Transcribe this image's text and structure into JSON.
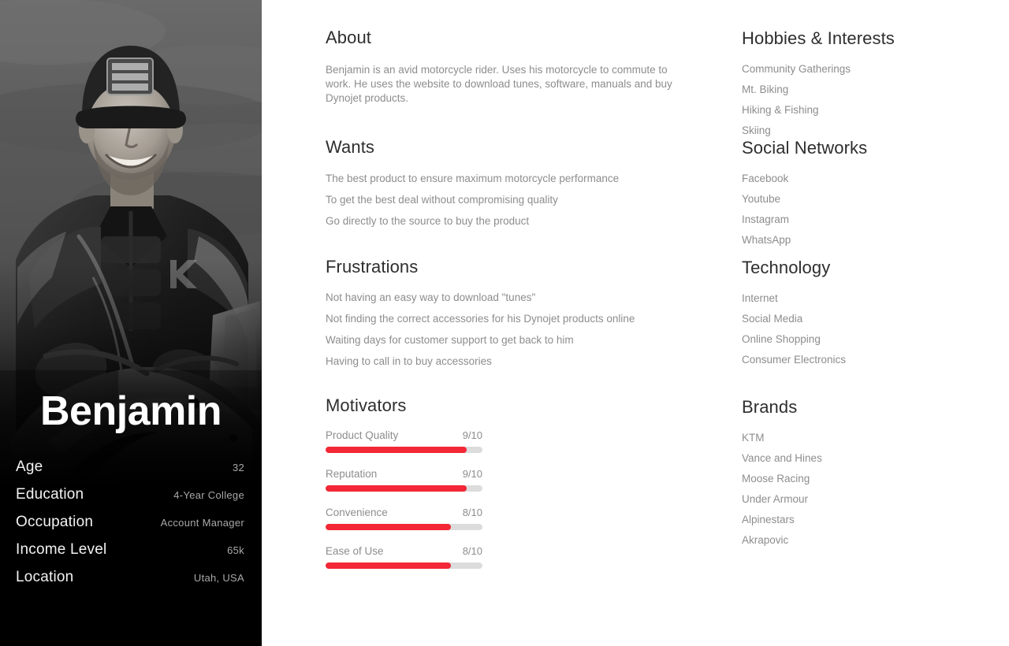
{
  "profile": {
    "name": "Benjamin",
    "photo_alt": "motorcycle-rider-portrait",
    "stats": [
      {
        "label": "Age",
        "value": "32"
      },
      {
        "label": "Education",
        "value": "4-Year College"
      },
      {
        "label": "Occupation",
        "value": "Account Manager"
      },
      {
        "label": "Income Level",
        "value": "65k"
      },
      {
        "label": "Location",
        "value": "Utah, USA"
      }
    ]
  },
  "about": {
    "title": "About",
    "text": "Benjamin is an avid motorcycle rider. Uses his motorcycle to commute to work.  He uses the website to download tunes, software, manuals and buy Dynojet products."
  },
  "wants": {
    "title": "Wants",
    "items": [
      "The best product to ensure maximum motorcycle performance",
      "To get the best deal without compromising quality",
      "Go directly to the source to buy the product"
    ]
  },
  "frustrations": {
    "title": "Frustrations",
    "items": [
      "Not having an easy way to download \"tunes\"",
      "Not finding the correct accessories for his Dynojet products online",
      "Waiting days for customer support to get back to him",
      "Having to call in to buy accessories"
    ]
  },
  "motivators": {
    "title": "Motivators",
    "items": [
      {
        "label": "Product Quality",
        "score": "9/10",
        "percent": 90
      },
      {
        "label": "Reputation",
        "score": "9/10",
        "percent": 90
      },
      {
        "label": "Convenience",
        "score": "8/10",
        "percent": 80
      },
      {
        "label": "Ease of Use",
        "score": "8/10",
        "percent": 80
      }
    ]
  },
  "hobbies": {
    "title": "Hobbies & Interests",
    "items": [
      "Community Gatherings",
      "Mt. Biking",
      "Hiking & Fishing",
      "Skiing"
    ]
  },
  "social_networks": {
    "title": "Social Networks",
    "items": [
      "Facebook",
      "Youtube",
      "Instagram",
      "WhatsApp"
    ]
  },
  "technology": {
    "title": "Technology",
    "items": [
      "Internet",
      " Social Media",
      "Online Shopping",
      "Consumer Electronics"
    ]
  },
  "brands": {
    "title": "Brands",
    "items": [
      "KTM",
      "Vance and Hines",
      "Moose Racing",
      "Under Armour",
      "Alpinestars",
      "Akrapovic"
    ]
  },
  "colors": {
    "accent": "#f32735",
    "track": "#dcdcdc",
    "panel": "#000000",
    "heading": "#2e2e2e",
    "body": "#8d8d8d"
  }
}
